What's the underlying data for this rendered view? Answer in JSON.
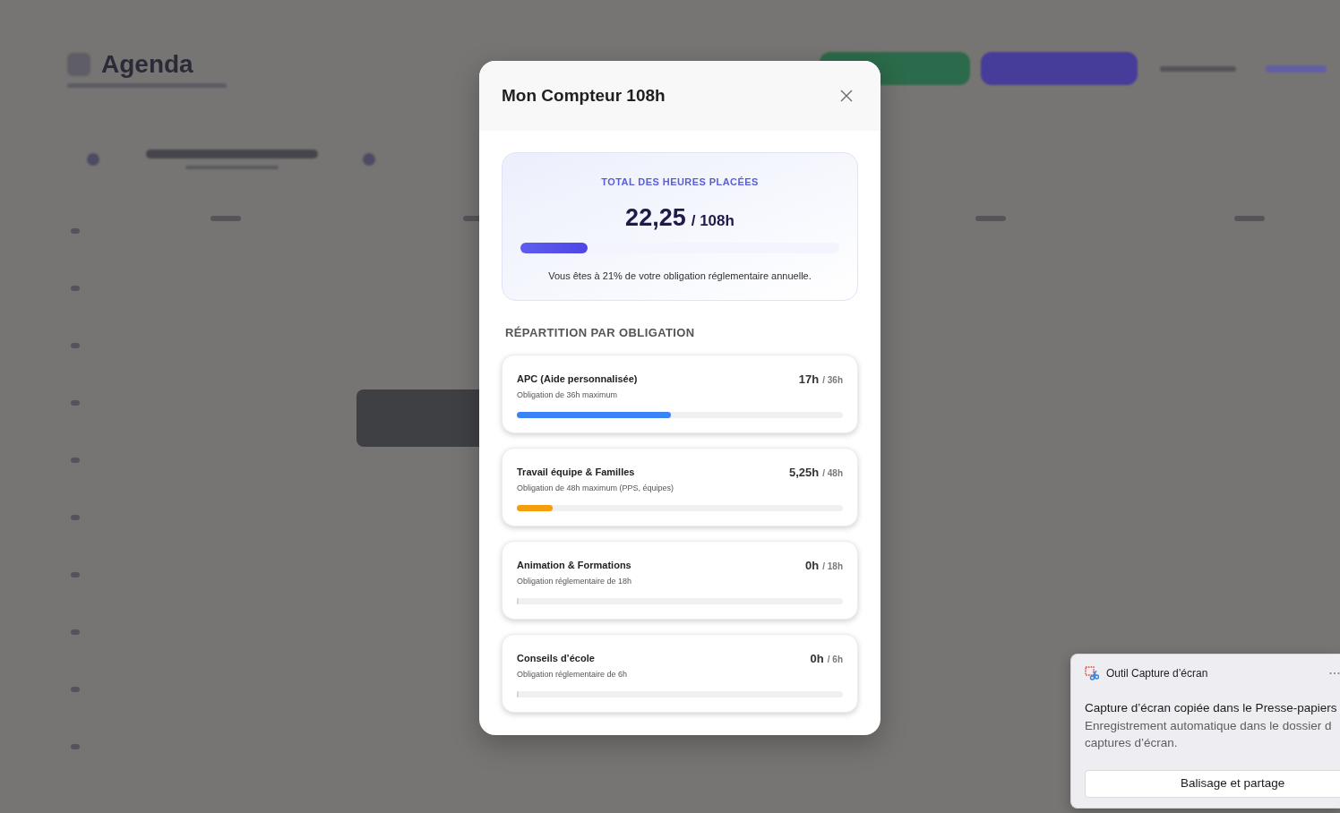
{
  "background": {
    "title": "Agenda"
  },
  "modal": {
    "title": "Mon Compteur 108h",
    "summary": {
      "label": "TOTAL DES HEURES PLACÉES",
      "value": "22,25",
      "total": "/ 108h",
      "level": 0.21,
      "note": "Vous êtes à 21% de votre obligation réglementaire annuelle."
    },
    "section_title": "RÉPARTITION PAR OBLIGATION",
    "obligations": [
      {
        "title": "APC (Aide personnalisée)",
        "subtitle": "Obligation de 36h maximum",
        "hours": "17h",
        "limit": "/ 36h",
        "level": 0.472,
        "color": "#3b82f6"
      },
      {
        "title": "Travail équipe & Familles",
        "subtitle": "Obligation de 48h maximum (PPS, équipes)",
        "hours": "5,25h",
        "limit": "/ 48h",
        "level": 0.109,
        "color": "#f59e0b"
      },
      {
        "title": "Animation & Formations",
        "subtitle": "Obligation réglementaire de 18h",
        "hours": "0h",
        "limit": "/ 18h",
        "level": 0
      },
      {
        "title": "Conseils d’école",
        "subtitle": "Obligation réglementaire de 6h",
        "hours": "0h",
        "limit": "/ 6h",
        "level": 0
      }
    ]
  },
  "notification": {
    "app": "Outil Capture d’écran",
    "title": "Capture d’écran copiée dans le Presse-papiers",
    "body_lines": [
      "Enregistrement automatique dans le dossier d",
      "captures d’écran."
    ],
    "action": "Balisage et partage"
  }
}
